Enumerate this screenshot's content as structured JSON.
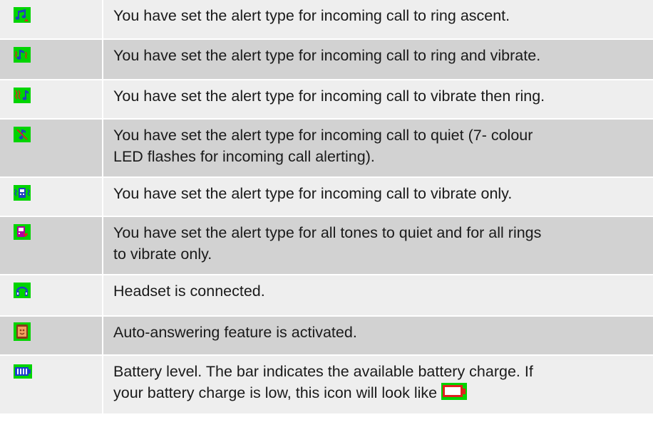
{
  "rows": [
    {
      "icon": "ring-ascent-icon",
      "text": [
        "You have set the alert type for incoming call to ring ascent."
      ]
    },
    {
      "icon": "ring-and-vibrate-icon",
      "text": [
        "You have set the alert type for incoming call to ring and vibrate."
      ]
    },
    {
      "icon": "vibrate-then-ring-icon",
      "text": [
        "You have set the alert type for incoming call to vibrate then ring."
      ]
    },
    {
      "icon": "quiet-led-icon",
      "text": [
        "You have set the alert type for incoming call to quiet (7- colour",
        "LED flashes for incoming call alerting)."
      ]
    },
    {
      "icon": "vibrate-only-icon",
      "text": [
        "You have set the alert type for incoming call to vibrate only."
      ]
    },
    {
      "icon": "quiet-tones-vibrate-rings-icon",
      "text": [
        "You have set the alert type for all tones to quiet and for all rings",
        "to vibrate only."
      ]
    },
    {
      "icon": "headset-icon",
      "text": [
        "Headset is connected."
      ]
    },
    {
      "icon": "auto-answer-icon",
      "text": [
        "Auto-answering feature is activated."
      ]
    },
    {
      "icon": "battery-full-icon",
      "text": [
        "Battery level. The bar indicates the available battery charge. If",
        "your battery charge is low, this icon will look like"
      ],
      "inline_icon": "battery-low-icon"
    }
  ],
  "colors": {
    "icon_bg": "#00d400",
    "row_light": "#eeeeee",
    "row_dark": "#d2d2d2",
    "note": "#2040c0",
    "alert": "#e02020"
  }
}
